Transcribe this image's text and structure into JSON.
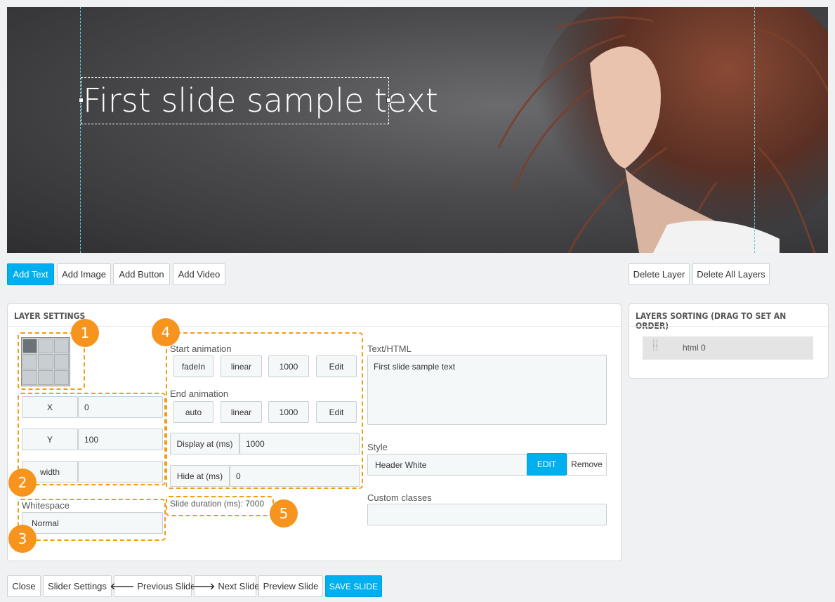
{
  "preview": {
    "layer_text": "First slide sample text"
  },
  "toolbar": {
    "add_text": "Add Text",
    "add_image": "Add Image",
    "add_button": "Add Button",
    "add_video": "Add Video",
    "delete_layer": "Delete Layer",
    "delete_all_layers": "Delete All Layers"
  },
  "layer_settings": {
    "title": "LAYER SETTINGS",
    "x_label": "X",
    "x_value": "0",
    "y_label": "Y",
    "y_value": "100",
    "width_label": "width",
    "width_value": "",
    "whitespace_label": "Whitespace",
    "whitespace_value": "Normal",
    "start_animation_label": "Start animation",
    "start_effect": "fadeIn",
    "start_easing": "linear",
    "start_speed": "1000",
    "start_edit": "Edit",
    "end_animation_label": "End animation",
    "end_effect": "auto",
    "end_easing": "linear",
    "end_speed": "1000",
    "end_edit": "Edit",
    "display_at_label": "Display at (ms)",
    "display_at_value": "1000",
    "hide_at_label": "Hide at (ms)",
    "hide_at_value": "0",
    "slide_duration": "Slide duration (ms): 7000",
    "text_html_label": "Text/HTML",
    "text_html_value": "First slide sample text",
    "style_label": "Style",
    "style_value": "Header White",
    "style_edit": "EDIT",
    "style_remove": "Remove",
    "custom_classes_label": "Custom classes",
    "custom_classes_value": ""
  },
  "annotations": [
    "1",
    "2",
    "3",
    "4",
    "5"
  ],
  "layers_sorting": {
    "title": "LAYERS SORTING (DRAG TO SET AN ORDER)",
    "items": [
      {
        "label": "html 0"
      }
    ]
  },
  "footer": {
    "close": "Close",
    "slider_settings": "Slider Settings",
    "previous_slide": "Previous Slide",
    "next_slide": "Next Slide",
    "preview_slide": "Preview Slide",
    "save_slide": "SAVE SLIDE"
  },
  "colors": {
    "accent": "#00aff0",
    "annotation": "#f7941d",
    "guide": "#5fd3d3"
  }
}
